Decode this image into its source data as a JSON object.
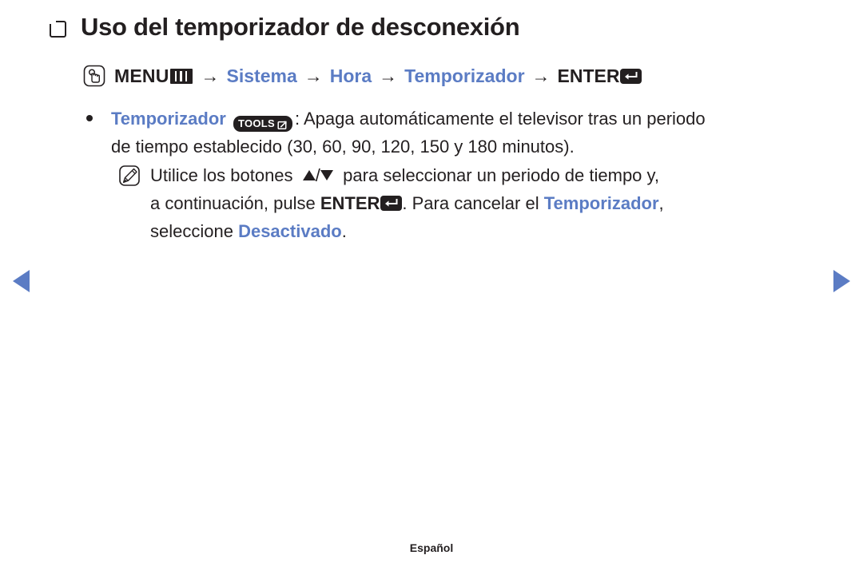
{
  "page": {
    "title": "Uso del temporizador de desconexión",
    "title_bullet_icon": "checkbox-square-icon",
    "footer_label": "Español",
    "accent_color": "#5b7cc4",
    "text_color": "#231f20",
    "background_color": "#ffffff"
  },
  "menu_path": {
    "hand_icon": "hand-press-icon",
    "menu_label": "MENU",
    "menu_glyph_icon": "menu-bars-icon",
    "separator": "→",
    "step1": "Sistema",
    "step2": "Hora",
    "step3": "Temporizador",
    "enter_label": "ENTER",
    "enter_glyph_icon": "enter-return-icon"
  },
  "bullet": {
    "dot_icon": "bullet-dot-icon",
    "keyword": "Temporizador",
    "tools_badge_label": "TOOLS",
    "tools_badge_icon": "tools-arrow-icon",
    "text_part1": ": Apaga automáticamente el televisor tras un periodo",
    "text_part2": "de tiempo establecido (30, 60, 90, 120, 150 y 180 minutos)."
  },
  "note": {
    "note_icon": "pencil-note-icon",
    "line1_prefix": "Utilice los botones",
    "arrow_up_icon": "triangle-up-icon",
    "arrow_slash": "/",
    "arrow_down_icon": "triangle-down-icon",
    "line1_suffix": "para seleccionar un periodo de tiempo y,",
    "line2_prefix": "a continuación, pulse",
    "line2_enter": "ENTER",
    "line2_enter_icon": "enter-return-icon",
    "line2_middle": ". Para cancelar el",
    "line2_keyword": "Temporizador",
    "line2_comma": ",",
    "line3_prefix": "seleccione",
    "line3_keyword": "Desactivado",
    "line3_suffix": "."
  },
  "navigation": {
    "prev_icon": "triangle-left-icon",
    "next_icon": "triangle-right-icon"
  }
}
